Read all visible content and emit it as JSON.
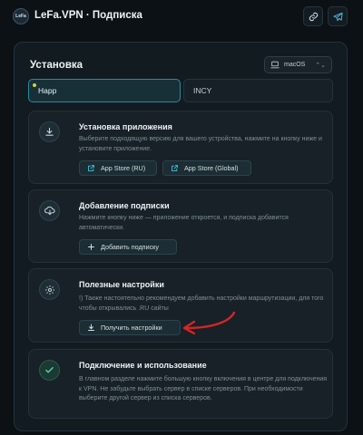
{
  "app": {
    "logo_text": "LeFa",
    "title": "LeFa.VPN · Подписка"
  },
  "header": {
    "link_icon": "link-icon",
    "telegram_icon": "telegram-icon"
  },
  "install": {
    "title": "Установка",
    "os_select": {
      "value": "macOS",
      "icon": "laptop-icon"
    },
    "tabs": [
      {
        "label": "Happ",
        "active": true
      },
      {
        "label": "INCY",
        "active": false
      }
    ]
  },
  "cards": [
    {
      "icon": "download-icon",
      "title": "Установка приложения",
      "description": "Выберите подходящую версию для вашего устройства, нажмите на кнопку ниже и установите приложение.",
      "buttons": [
        {
          "label": "App Store (RU)",
          "icon": "external-link-icon"
        },
        {
          "label": "App Store (Global)",
          "icon": "external-link-icon"
        }
      ]
    },
    {
      "icon": "cloud-download-icon",
      "title": "Добавление подписки",
      "description": "Нажмите кнопку ниже — приложение откроется, и подписка добавится автоматически.",
      "buttons": [
        {
          "label": "Добавить подписку",
          "icon": "plus-icon"
        }
      ]
    },
    {
      "icon": "gear-icon",
      "title": "Полезные настройки",
      "description": "!) Также настоятельно рекомендуем добавить настройки маршрутизации, для того чтобы открывались .RU сайты",
      "buttons": [
        {
          "label": "Получить настройки",
          "icon": "download-icon"
        }
      ]
    },
    {
      "icon": "check-icon",
      "title": "Подключение и использование",
      "description": "В главном разделе нажмите большую кнопку включения в центре для подключения к VPN. Не забудьте выбрать сервер в списке серверов. При необходимости выберите другой сервер из списка серверов."
    }
  ],
  "colors": {
    "accent": "#2a8aa0",
    "arrow": "#d62525",
    "background": "#0b1115"
  }
}
